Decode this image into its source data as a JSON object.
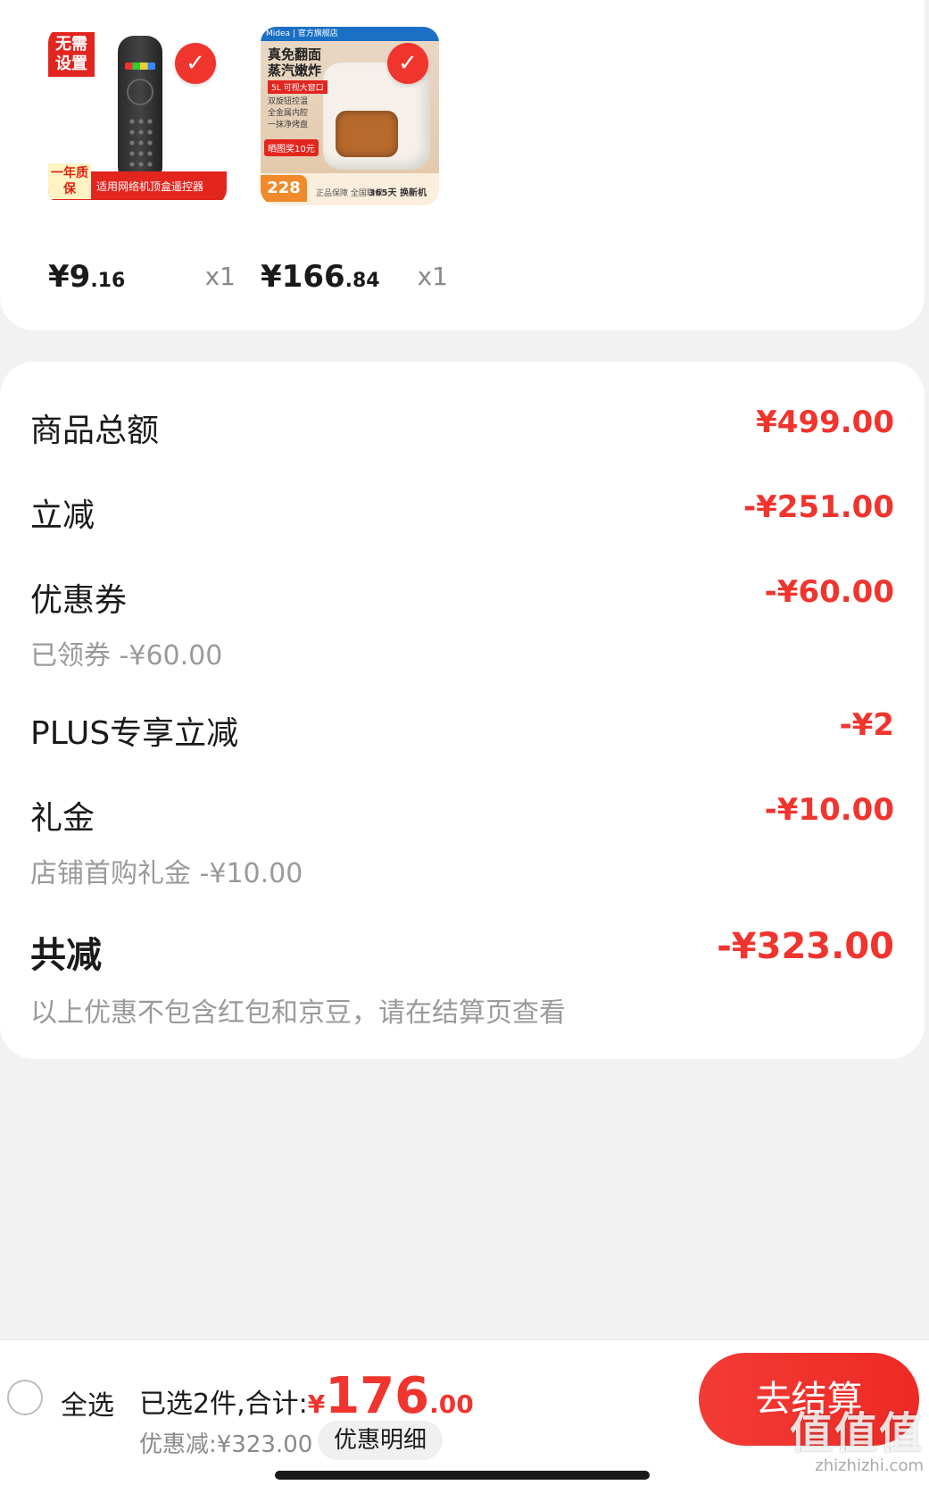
{
  "products": [
    {
      "price_int": "¥9",
      "price_dec": ".16",
      "qty": "x1",
      "thumb_tag_top": "无需设置",
      "thumb_tag_year": "一年质保",
      "thumb_tag_desc": "适用网络机顶盒遥控器",
      "icon": "check-icon"
    },
    {
      "price_int": "¥166",
      "price_dec": ".84",
      "qty": "x1",
      "thumb_brand": "Midea | 官方旗舰店",
      "thumb_title": "真免翻面蒸汽嫩炸",
      "thumb_capacity": "5L 可视大窗口",
      "thumb_features": [
        "双旋钮控温",
        "全金属内腔",
        "一抹净烤盘"
      ],
      "thumb_rebate": "晒图奖10元",
      "thumb_price": "228",
      "thumb_badge": "正品保障 全国联保",
      "thumb_365": "365天 换新机",
      "icon": "check-icon"
    }
  ],
  "summary": {
    "goods_total_label": "商品总额",
    "goods_total_value": "¥499.00",
    "instant_label": "立减",
    "instant_value": "-¥251.00",
    "coupon_label": "优惠券",
    "coupon_value": "-¥60.00",
    "coupon_sub": "已领券 -¥60.00",
    "plus_label": "PLUS专享立减",
    "plus_value": "-¥2",
    "gift_label": "礼金",
    "gift_value": "-¥10.00",
    "gift_sub": "店铺首购礼金 -¥10.00",
    "total_label": "共减",
    "total_value": "-¥323.00",
    "total_sub": "以上优惠不包含红包和京豆，请在结算页查看"
  },
  "bottom": {
    "select_all": "全选",
    "selected_prefix": "已选2件,合计:",
    "total_yen": "¥",
    "total_int": "176",
    "total_dec": ".00",
    "discount": "优惠减:¥323.00",
    "detail_button": "优惠明细",
    "checkout_button": "去结算",
    "watermark_main": "值值值",
    "watermark_url": "zhizhizhi.com"
  },
  "colors": {
    "accent": "#f0342e",
    "background": "#f2f2f2",
    "card": "#ffffff",
    "muted": "#9a9a9a"
  }
}
